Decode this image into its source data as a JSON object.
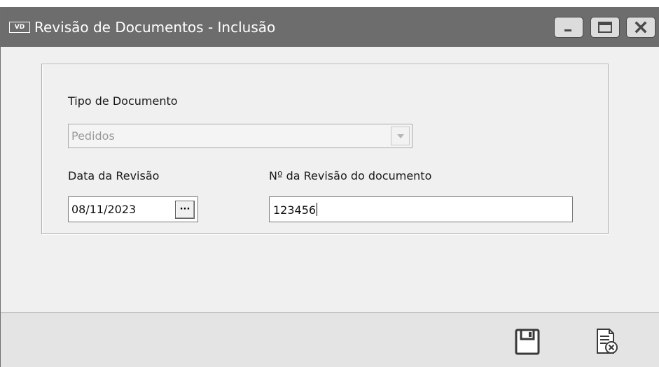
{
  "window": {
    "icon_text": "VD",
    "title": "Revisão de Documentos - Inclusão",
    "controls": {
      "minimize": "minimize-icon",
      "maximize": "maximize-icon",
      "close": "close-icon"
    }
  },
  "form": {
    "tipo_documento": {
      "label": "Tipo de Documento",
      "value": "Pedidos",
      "enabled": false
    },
    "data_revisao": {
      "label": "Data da Revisão",
      "value": "08/11/2023",
      "button_label": "···"
    },
    "numero_revisao": {
      "label": "Nº da Revisão do documento",
      "value": "123456"
    }
  },
  "toolbar": {
    "save_icon": "floppy-disk-icon",
    "cancel_icon": "document-cancel-icon"
  },
  "colors": {
    "titlebar": "#6d6d6d",
    "window_bg": "#f0f0f0",
    "bottombar": "#e4e4e4"
  }
}
